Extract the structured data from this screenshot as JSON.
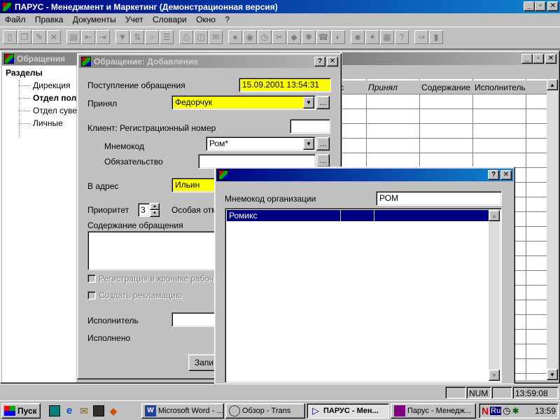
{
  "app": {
    "title": "ПАРУС - Менеджмент и Маркетинг (Демонстрационная версия)",
    "menu": [
      "Файл",
      "Правка",
      "Документы",
      "Учет",
      "Словари",
      "Окно",
      "?"
    ],
    "toolbar_icons": [
      "new-doc-icon",
      "copy-doc-icon",
      "edit-doc-icon",
      "delete-icon",
      "insert-icon",
      "import-icon",
      "export-icon",
      "filter-icon",
      "sort-icon",
      "find-icon",
      "list-icon",
      "print-icon",
      "preview-icon",
      "send-icon",
      "calendar-icon",
      "report-icon",
      "clock-icon",
      "tools-icon",
      "chart-icon",
      "settings-icon",
      "phone-icon",
      "person-icon",
      "network-icon",
      "calculator-icon",
      "help-icon",
      "exit-icon",
      "door-icon"
    ]
  },
  "sections_window": {
    "title": "Обращения",
    "tree_root": "Разделы",
    "tree_items": [
      {
        "label": "Дирекция",
        "bold": false
      },
      {
        "label": "Отдел поли",
        "bold": true
      },
      {
        "label": "Отдел сувен",
        "bold": false
      },
      {
        "label": "Личные",
        "bold": false
      }
    ],
    "columns": [
      "с",
      "Принял",
      "Содержание",
      "Исполнитель"
    ]
  },
  "dialog": {
    "title": "Обращение: Добавление",
    "received_label": "Поступление обращения",
    "received_value": "15.09.2001 13:54:31",
    "accepted_label": "Принял",
    "accepted_value": "Федорчук",
    "client_label": "Клиент: Регистрационный номер",
    "client_value": "",
    "mnemo_label": "Мнемокод",
    "mnemo_value": "Ром*",
    "obligation_label": "Обязательство",
    "obligation_value": "",
    "address_label": "В адрес",
    "address_value": "Ильин",
    "priority_label": "Приоритет",
    "priority_value": "3",
    "special_label": "Особая отм",
    "content_label": "Содержание обращения",
    "content_value": "",
    "chk_register_label": "Регистрация в хронике рабоч",
    "chk_claim_label": "Создать рекламацию",
    "executor_label": "Исполнитель",
    "executor_value": "",
    "done_label": "Исполнено",
    "save_label": "Запи"
  },
  "popup": {
    "title": "",
    "mnemo_label": "Мнемокод организации",
    "mnemo_value": "РОМ",
    "list_items": [
      "Ромикс"
    ]
  },
  "statusbar": {
    "num": "NUM",
    "time": "13:59:08"
  },
  "taskbar": {
    "start_label": "Пуск",
    "quicklaunch": [
      "desktop-icon",
      "browser-icon",
      "outlook-icon",
      "channels-icon",
      "fox-icon"
    ],
    "tasks": [
      {
        "label": "Microsoft Word - ...",
        "active": false
      },
      {
        "label": "Обзор - Trans",
        "active": false
      },
      {
        "label": "ПАРУС - Мен...",
        "active": true
      },
      {
        "label": "Парус - Менедж...",
        "active": false
      }
    ],
    "lang": "Ru",
    "clock": "13:59"
  }
}
